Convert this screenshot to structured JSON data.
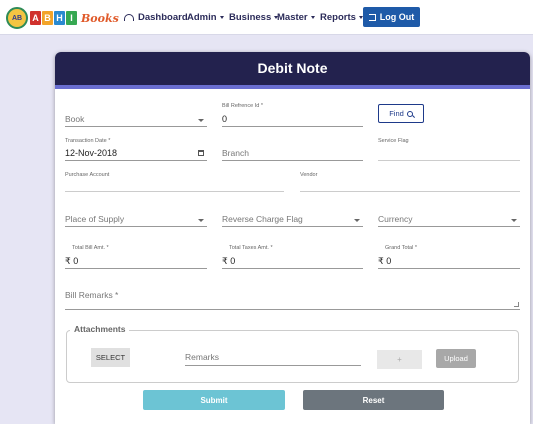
{
  "brand": {
    "logo_letters": [
      "A",
      "B",
      "H",
      "I"
    ],
    "logo_suffix": "Books",
    "emblem_text": "AB"
  },
  "nav": {
    "dashboard": "Dashboard",
    "admin": "Admin",
    "business": "Business",
    "master": "Master",
    "reports": "Reports",
    "logout": "Log Out"
  },
  "page": {
    "title": "Debit Note"
  },
  "form": {
    "book": {
      "placeholder": "Book"
    },
    "bill_reference": {
      "label": "Bill Refrence Id *",
      "value": "0"
    },
    "find_button": "Find",
    "transaction_date": {
      "label": "Transaction Date *",
      "value": "12-Nov-2018"
    },
    "branch": {
      "placeholder": "Branch"
    },
    "service_flag": {
      "label": "Service Flag"
    },
    "purchase_account": {
      "label": "Purchase Account"
    },
    "vendor": {
      "label": "Vendor"
    },
    "place_of_supply": {
      "placeholder": "Place of Supply"
    },
    "reverse_charge_flag": {
      "placeholder": "Reverse Charge Flag"
    },
    "currency": {
      "placeholder": "Currency"
    },
    "total_bill_amt": {
      "label": "Total Bill Amt. *",
      "currency_symbol": "₹",
      "value": "0"
    },
    "total_taxes_amt": {
      "label": "Total Taxes Amt. *",
      "currency_symbol": "₹",
      "value": "0"
    },
    "grand_total": {
      "label": "Grand Total *",
      "currency_symbol": "₹",
      "value": "0"
    },
    "bill_remarks": {
      "placeholder": "Bill Remarks *"
    }
  },
  "attachments": {
    "legend": "Attachments",
    "select_button": "SELECT",
    "remarks_placeholder": "Remarks",
    "add_button": "+",
    "upload_button": "Upload"
  },
  "actions": {
    "submit": "Submit",
    "reset": "Reset"
  },
  "colors": {
    "header_bg": "#23224e",
    "header_accent": "#6a6ed0",
    "logout_bg": "#1e5aa8",
    "submit_bg": "#6cc4d4",
    "reset_bg": "#6c757d"
  }
}
